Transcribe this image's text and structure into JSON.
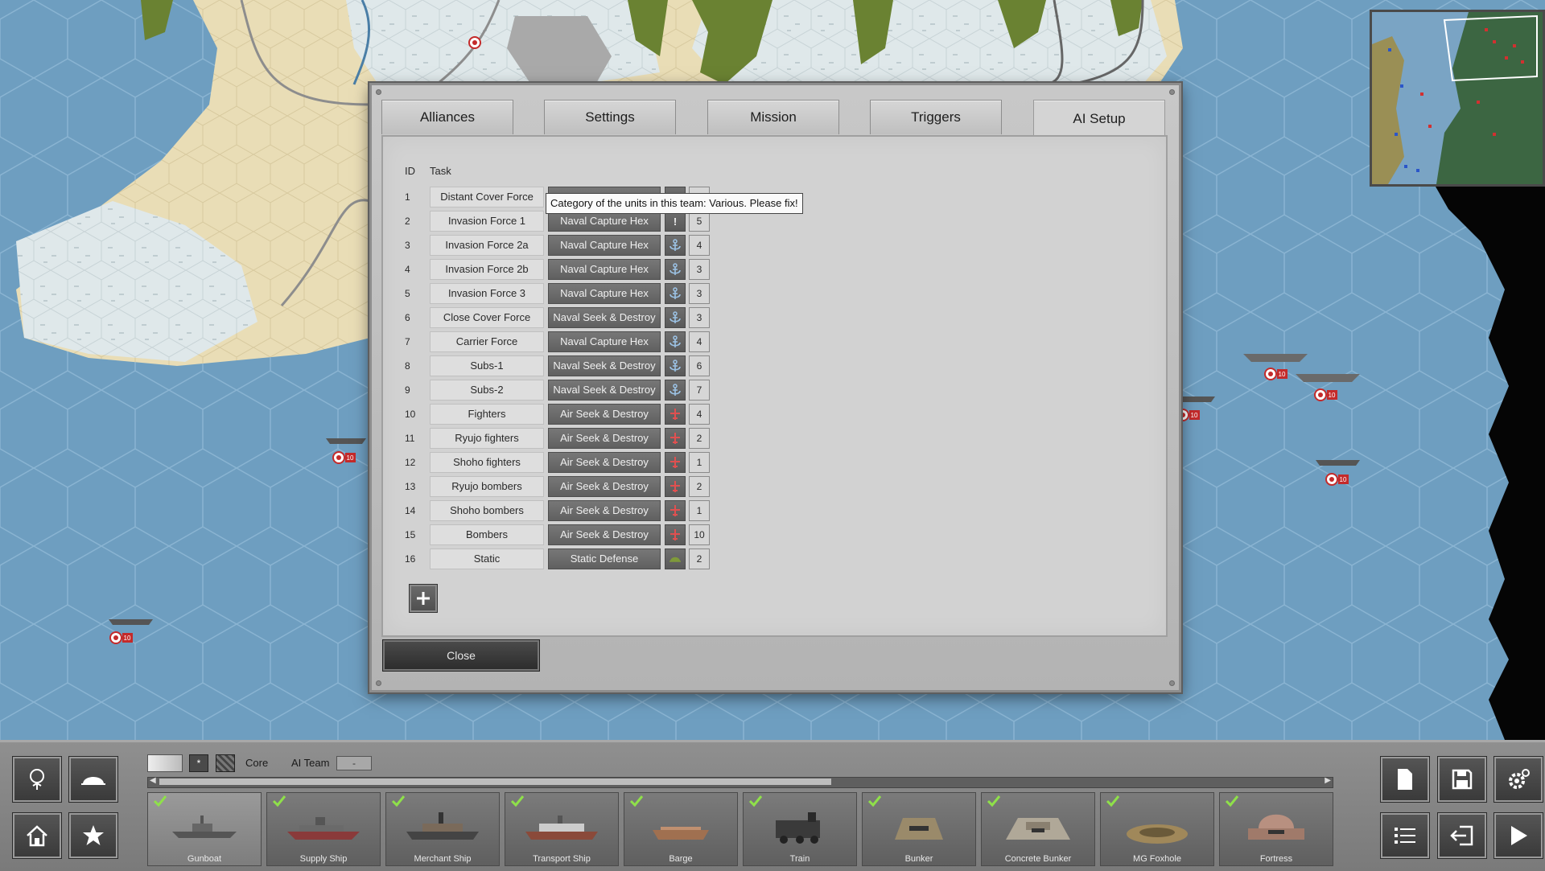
{
  "dialog": {
    "tabs": [
      "Alliances",
      "Settings",
      "Mission",
      "Triggers",
      "AI Setup"
    ],
    "active_tab": "AI Setup",
    "columns": {
      "id": "ID",
      "task": "Task"
    },
    "tooltip": "Category of the units in this team: Various. Please fix!",
    "rows": [
      {
        "id": "1",
        "task": "Distant Cover Force",
        "order": "",
        "category": "",
        "count": ""
      },
      {
        "id": "2",
        "task": "Invasion Force 1",
        "order": "Naval Capture Hex",
        "category": "warning-icon",
        "count": "5"
      },
      {
        "id": "3",
        "task": "Invasion Force 2a",
        "order": "Naval Capture Hex",
        "category": "anchor-icon",
        "count": "4"
      },
      {
        "id": "4",
        "task": "Invasion Force 2b",
        "order": "Naval Capture Hex",
        "category": "anchor-icon",
        "count": "3"
      },
      {
        "id": "5",
        "task": "Invasion Force 3",
        "order": "Naval Capture Hex",
        "category": "anchor-icon",
        "count": "3"
      },
      {
        "id": "6",
        "task": "Close Cover Force",
        "order": "Naval Seek & Destroy",
        "category": "anchor-icon",
        "count": "3"
      },
      {
        "id": "7",
        "task": "Carrier Force",
        "order": "Naval Capture Hex",
        "category": "anchor-icon",
        "count": "4"
      },
      {
        "id": "8",
        "task": "Subs-1",
        "order": "Naval Seek & Destroy",
        "category": "anchor-icon",
        "count": "6"
      },
      {
        "id": "9",
        "task": "Subs-2",
        "order": "Naval Seek & Destroy",
        "category": "anchor-icon",
        "count": "7"
      },
      {
        "id": "10",
        "task": "Fighters",
        "order": "Air Seek & Destroy",
        "category": "plane-icon",
        "count": "4"
      },
      {
        "id": "11",
        "task": "Ryujo fighters",
        "order": "Air Seek & Destroy",
        "category": "plane-icon",
        "count": "2"
      },
      {
        "id": "12",
        "task": "Shoho fighters",
        "order": "Air Seek & Destroy",
        "category": "plane-icon",
        "count": "1"
      },
      {
        "id": "13",
        "task": "Ryujo bombers",
        "order": "Air Seek & Destroy",
        "category": "plane-icon",
        "count": "2"
      },
      {
        "id": "14",
        "task": "Shoho bombers",
        "order": "Air Seek & Destroy",
        "category": "plane-icon",
        "count": "1"
      },
      {
        "id": "15",
        "task": "Bombers",
        "order": "Air Seek & Destroy",
        "category": "plane-icon",
        "count": "10"
      },
      {
        "id": "16",
        "task": "Static",
        "order": "Static Defense",
        "category": "helmet-icon",
        "count": "2"
      }
    ],
    "add_button": "plus-icon",
    "close_label": "Close"
  },
  "map": {
    "unit_badge": "10"
  },
  "bottom_bar": {
    "core_label": "Core",
    "ai_team_label": "AI Team",
    "ai_team_value": "-",
    "units": [
      {
        "name": "Gunboat",
        "selected": true
      },
      {
        "name": "Supply Ship",
        "selected": false
      },
      {
        "name": "Merchant Ship",
        "selected": false
      },
      {
        "name": "Transport Ship",
        "selected": false
      },
      {
        "name": "Barge",
        "selected": false
      },
      {
        "name": "Train",
        "selected": false
      },
      {
        "name": "Bunker",
        "selected": false
      },
      {
        "name": "Concrete Bunker",
        "selected": false
      },
      {
        "name": "MG Foxhole",
        "selected": false
      },
      {
        "name": "Fortress",
        "selected": false
      }
    ],
    "left_buttons": [
      "tree-icon",
      "helmet-icon",
      "home-icon",
      "star-icon"
    ],
    "right_buttons": [
      "page-icon",
      "save-icon",
      "settings-icon",
      "list-icon",
      "exit-icon",
      "play-icon"
    ]
  },
  "colors": {
    "sea": "#6e9ec0",
    "sea_line": "#8ab4d2",
    "land": "#e9ddb6",
    "marsh": "#dfe8ea",
    "forest": "#6a8232",
    "urban": "#a9a9a9",
    "enemy_marker": "#c42a2a"
  }
}
